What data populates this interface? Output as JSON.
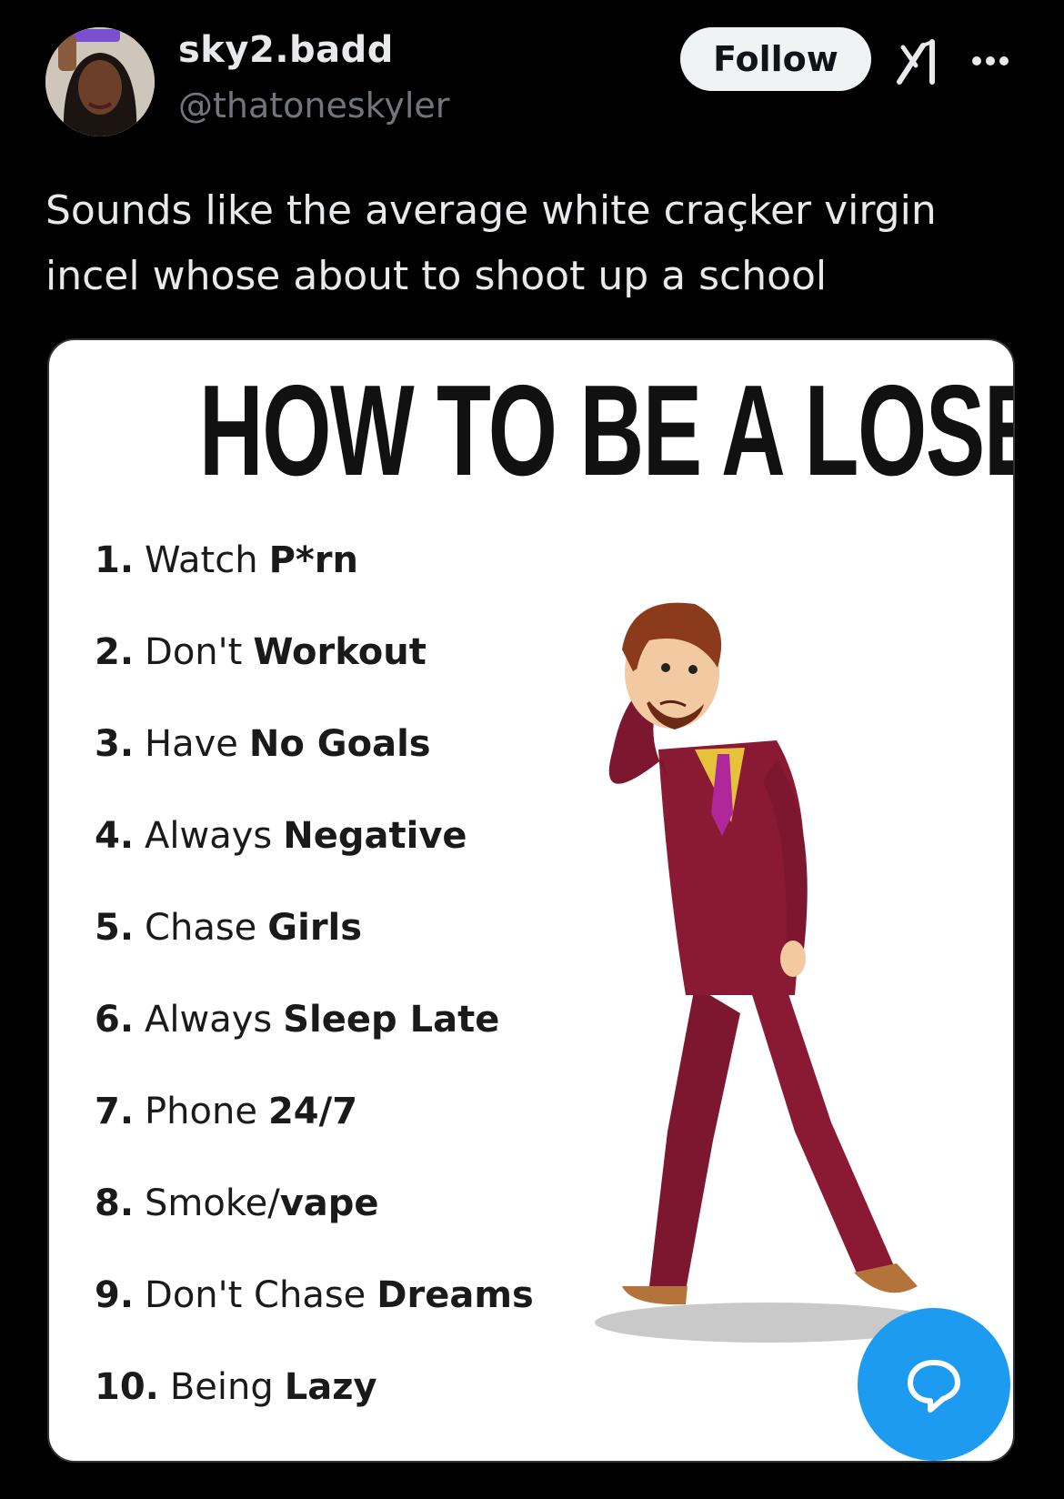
{
  "author": {
    "name": "sky2.badd",
    "handle": "@thatoneskyler",
    "avatar_icon": "profile-photo"
  },
  "actions": {
    "follow_label": "Follow",
    "grok_icon": "grok-icon",
    "more_icon": "more-dots-icon",
    "reply_icon": "chat-bubble-icon"
  },
  "tweet": {
    "line1": "Sounds like the average white craçker virgin",
    "line2": "incel whose about to shoot up a school"
  },
  "meme": {
    "title": "HOW TO BE A LOSER",
    "items": [
      {
        "num": "1.",
        "plain": "Watch",
        "bold": "P*rn"
      },
      {
        "num": "2.",
        "plain": "Don't",
        "bold": "Workout"
      },
      {
        "num": "3.",
        "plain": "Have",
        "bold": "No Goals"
      },
      {
        "num": "4.",
        "plain": "Always",
        "bold": "Negative"
      },
      {
        "num": "5.",
        "plain": "Chase",
        "bold": "Girls"
      },
      {
        "num": "6.",
        "plain": "Always",
        "bold": "Sleep Late"
      },
      {
        "num": "7.",
        "plain": "Phone",
        "bold": "24/7"
      },
      {
        "num": "8.",
        "plain": "Smoke/",
        "bold": "vape"
      },
      {
        "num": "9.",
        "plain": "Don't Chase",
        "bold": "Dreams"
      },
      {
        "num": "10.",
        "plain": "Being",
        "bold": "Lazy"
      }
    ],
    "illustration": "sad-man-in-suit"
  },
  "colors": {
    "background": "#000000",
    "text": "#e7e9ea",
    "muted": "#71767b",
    "accent": "#1d9bf0",
    "suit": "#8a1a34"
  }
}
